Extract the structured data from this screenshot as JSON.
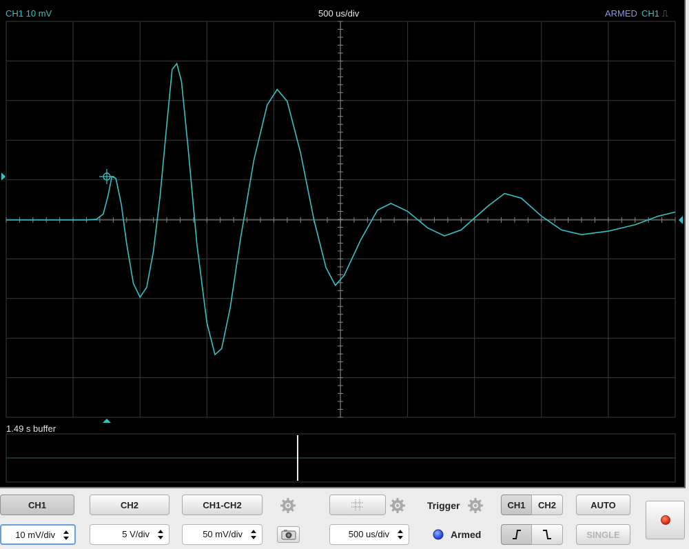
{
  "display": {
    "channel_readout": "CH1 10 mV",
    "timebase_readout": "500 us/div",
    "status": "ARMED",
    "trigger_channel": "CH1 ⎍",
    "buffer_label": "1.49 s buffer"
  },
  "trace": {
    "color": "#35c3c6",
    "units": {
      "x": "divisions",
      "y": "divisions"
    },
    "points": [
      [
        0,
        0
      ],
      [
        1.2,
        0
      ],
      [
        1.35,
        0.02
      ],
      [
        1.45,
        0.15
      ],
      [
        1.52,
        0.6
      ],
      [
        1.58,
        1.1
      ],
      [
        1.64,
        1.05
      ],
      [
        1.72,
        0.4
      ],
      [
        1.8,
        -0.6
      ],
      [
        1.9,
        -1.6
      ],
      [
        2.0,
        -1.95
      ],
      [
        2.1,
        -1.7
      ],
      [
        2.2,
        -0.8
      ],
      [
        2.3,
        0.6
      ],
      [
        2.4,
        2.4
      ],
      [
        2.48,
        3.8
      ],
      [
        2.55,
        3.95
      ],
      [
        2.62,
        3.5
      ],
      [
        2.72,
        1.8
      ],
      [
        2.85,
        -0.6
      ],
      [
        3.0,
        -2.6
      ],
      [
        3.12,
        -3.4
      ],
      [
        3.22,
        -3.25
      ],
      [
        3.35,
        -2.2
      ],
      [
        3.5,
        -0.5
      ],
      [
        3.7,
        1.5
      ],
      [
        3.9,
        2.9
      ],
      [
        4.05,
        3.3
      ],
      [
        4.2,
        3.0
      ],
      [
        4.4,
        1.7
      ],
      [
        4.6,
        0
      ],
      [
        4.78,
        -1.2
      ],
      [
        4.92,
        -1.65
      ],
      [
        5.05,
        -1.4
      ],
      [
        5.3,
        -0.5
      ],
      [
        5.55,
        0.25
      ],
      [
        5.75,
        0.42
      ],
      [
        6.0,
        0.22
      ],
      [
        6.3,
        -0.2
      ],
      [
        6.55,
        -0.4
      ],
      [
        6.8,
        -0.25
      ],
      [
        7.2,
        0.35
      ],
      [
        7.45,
        0.67
      ],
      [
        7.7,
        0.55
      ],
      [
        8.0,
        0.1
      ],
      [
        8.3,
        -0.25
      ],
      [
        8.6,
        -0.37
      ],
      [
        9.0,
        -0.28
      ],
      [
        9.4,
        -0.12
      ],
      [
        9.75,
        0.1
      ],
      [
        10.0,
        0.2
      ]
    ]
  },
  "buttons": {
    "ch1": "CH1",
    "ch2": "CH2",
    "ch1_ch2": "CH1-CH2",
    "trigger_label": "Trigger",
    "trig_ch1": "CH1",
    "trig_ch2": "CH2",
    "auto": "AUTO",
    "single": "SINGLE",
    "armed_label": "Armed"
  },
  "steppers": {
    "ch1_scale": "10 mV/div",
    "ch2_scale": "5 V/div",
    "math_scale": "50 mV/div",
    "timebase": "500 us/div"
  },
  "icons": {
    "gear": "gear-icon",
    "grid": "grid-icon",
    "camera": "camera-icon",
    "record": "record-icon",
    "armed_led": "led-indicator-icon"
  }
}
